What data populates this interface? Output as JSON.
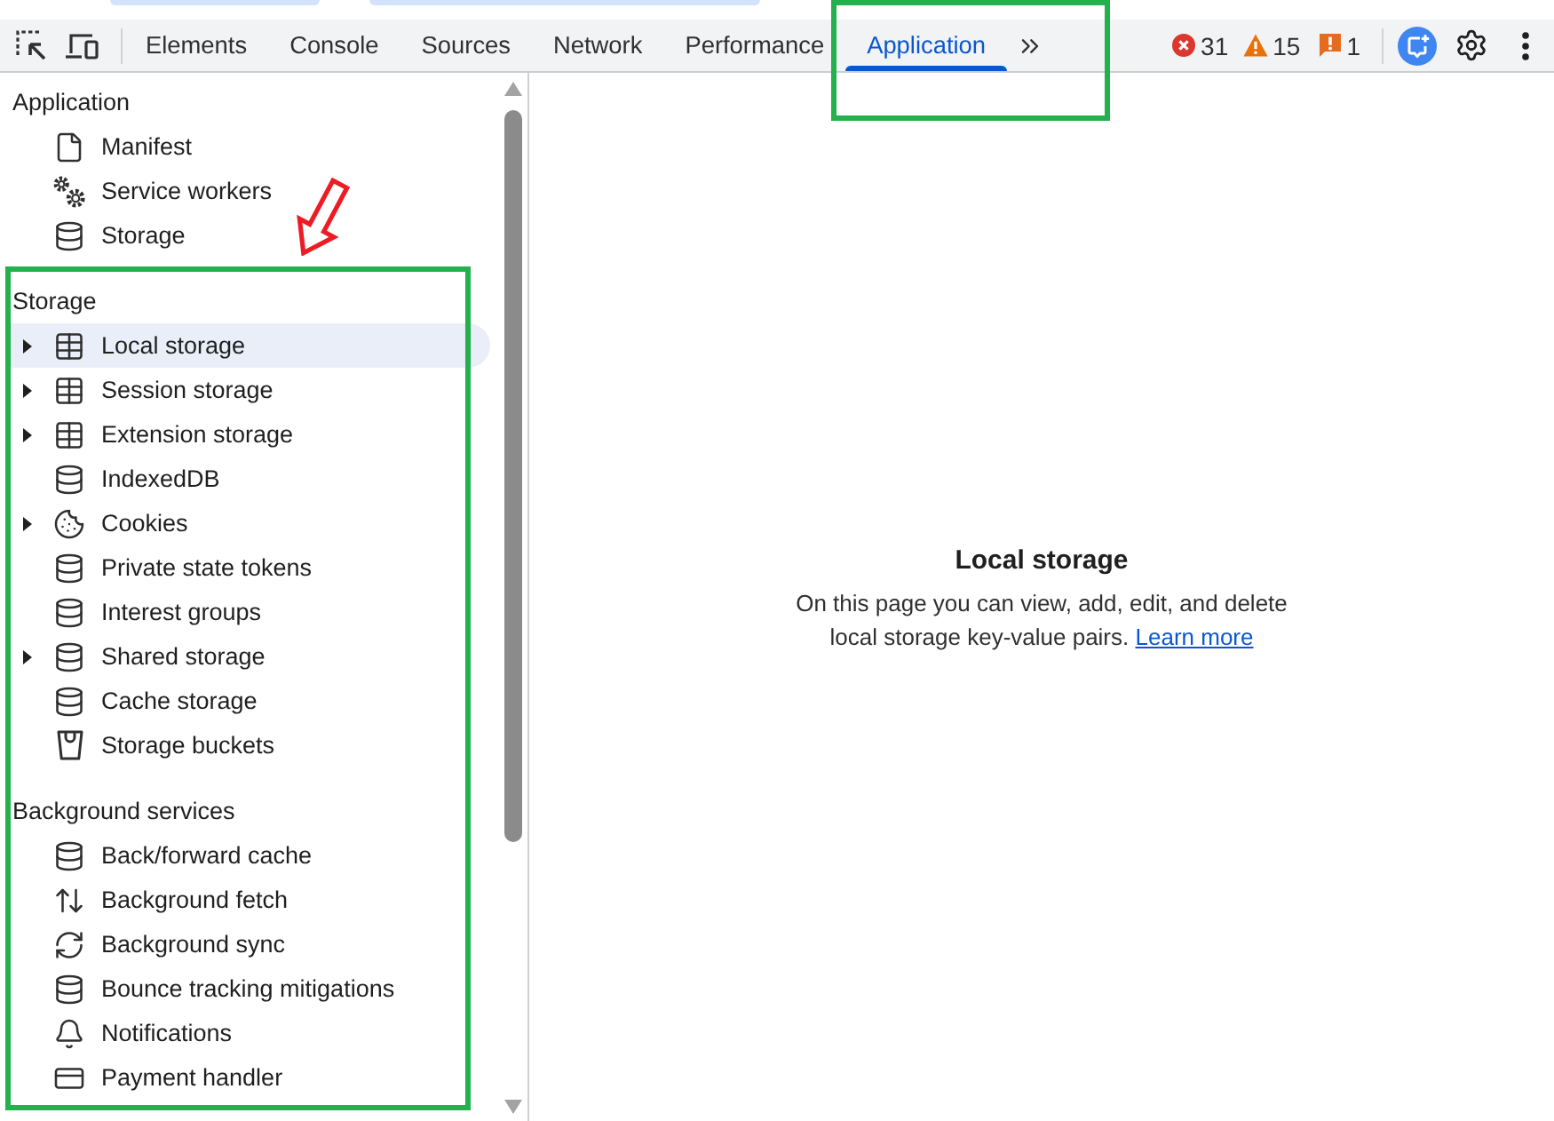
{
  "toolbar": {
    "tabs": [
      {
        "label": "Elements",
        "selected": false
      },
      {
        "label": "Console",
        "selected": false
      },
      {
        "label": "Sources",
        "selected": false
      },
      {
        "label": "Network",
        "selected": false
      },
      {
        "label": "Performance",
        "selected": false
      },
      {
        "label": "Application",
        "selected": true
      }
    ],
    "counters": [
      {
        "kind": "errors",
        "count": "31"
      },
      {
        "kind": "warnings",
        "count": "15"
      },
      {
        "kind": "issues",
        "count": "1"
      }
    ]
  },
  "sidebar": {
    "sections": [
      {
        "title": "Application",
        "items": [
          {
            "label": "Manifest",
            "selected": false
          },
          {
            "label": "Service workers",
            "selected": false
          },
          {
            "label": "Storage",
            "selected": false
          }
        ]
      },
      {
        "title": "Storage",
        "items": [
          {
            "label": "Local storage",
            "selected": true,
            "expanded": false
          },
          {
            "label": "Session storage",
            "selected": false,
            "expanded": false
          },
          {
            "label": "Extension storage",
            "selected": false,
            "expanded": false
          },
          {
            "label": "IndexedDB",
            "selected": false
          },
          {
            "label": "Cookies",
            "selected": false,
            "expanded": false
          },
          {
            "label": "Private state tokens",
            "selected": false
          },
          {
            "label": "Interest groups",
            "selected": false
          },
          {
            "label": "Shared storage",
            "selected": false,
            "expanded": false
          },
          {
            "label": "Cache storage",
            "selected": false
          },
          {
            "label": "Storage buckets",
            "selected": false
          }
        ]
      },
      {
        "title": "Background services",
        "items": [
          {
            "label": "Back/forward cache",
            "selected": false
          },
          {
            "label": "Background fetch",
            "selected": false
          },
          {
            "label": "Background sync",
            "selected": false
          },
          {
            "label": "Bounce tracking mitigations",
            "selected": false
          },
          {
            "label": "Notifications",
            "selected": false
          },
          {
            "label": "Payment handler",
            "selected": false
          }
        ]
      }
    ]
  },
  "panel": {
    "title": "Local storage",
    "description": "On this page you can view, add, edit, and delete local storage key-value pairs.",
    "link": "Learn more"
  },
  "annotations": [
    {
      "kind": "frame"
    },
    {
      "kind": "frame"
    },
    {
      "kind": "arrow"
    }
  ]
}
